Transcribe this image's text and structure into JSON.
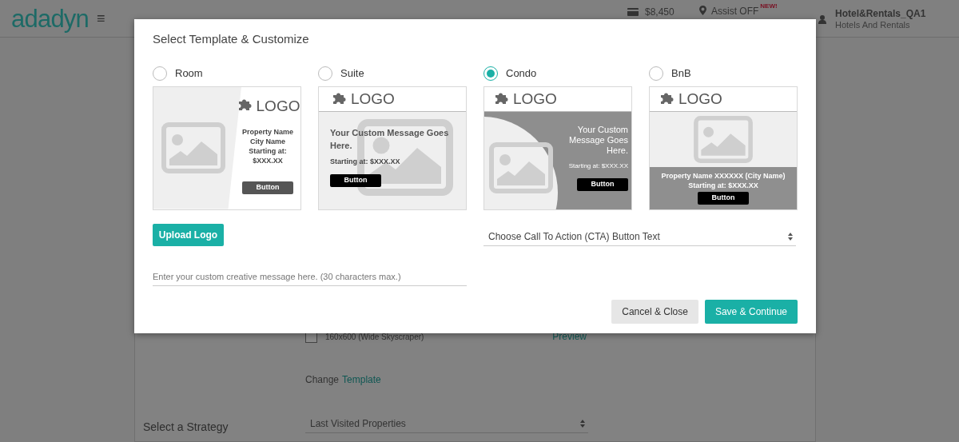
{
  "header": {
    "logo": "adadyn",
    "menu_glyph": "≡",
    "balance": "$8,450",
    "assist": "Assist OFF",
    "assist_badge": "NEW!",
    "account_name": "Hotel&Rentals_QA1",
    "account_type": "Hotels And Rentals"
  },
  "page": {
    "ad_sizes": [
      {
        "label": "160x600 (Wide Skyscraper)",
        "checked": false,
        "action": "Preview"
      }
    ],
    "change_template": {
      "text": "Change",
      "link": "Template"
    },
    "strategy": {
      "label": "Select a Strategy",
      "value": "Last Visited Properties"
    }
  },
  "modal": {
    "title": "Select Template & Customize",
    "templates": [
      {
        "label": "Room",
        "selected": false,
        "kind": "split",
        "logo": "LOGO",
        "lines": [
          "Property Name",
          "City Name",
          "Starting at:",
          "$XXX.XX"
        ],
        "button": "Button"
      },
      {
        "label": "Suite",
        "selected": false,
        "kind": "banner",
        "logo": "LOGO",
        "message": "Your Custom Message Goes Here.",
        "price": "Starting at: $XXX.XX",
        "button": "Button"
      },
      {
        "label": "Condo",
        "selected": true,
        "kind": "curve",
        "logo": "LOGO",
        "message": "Your Custom Message Goes Here.",
        "price": "Starting at: $XXX.XX",
        "button": "Button"
      },
      {
        "label": "BnB",
        "selected": false,
        "kind": "stacked",
        "logo": "LOGO",
        "lines": [
          "Property Name XXXXXX (City Name)",
          "Starting at: $XXX.XX"
        ],
        "button": "Button"
      }
    ],
    "upload_button": "Upload Logo",
    "cta_select": {
      "placeholder": "Choose Call To Action (CTA) Button Text"
    },
    "message_field": {
      "placeholder": "Enter your custom creative message here. (30 characters max.)"
    },
    "buttons": [
      {
        "label": "Cancel & Close",
        "kind": "secondary"
      },
      {
        "label": "Save & Continue",
        "kind": "primary"
      }
    ]
  }
}
